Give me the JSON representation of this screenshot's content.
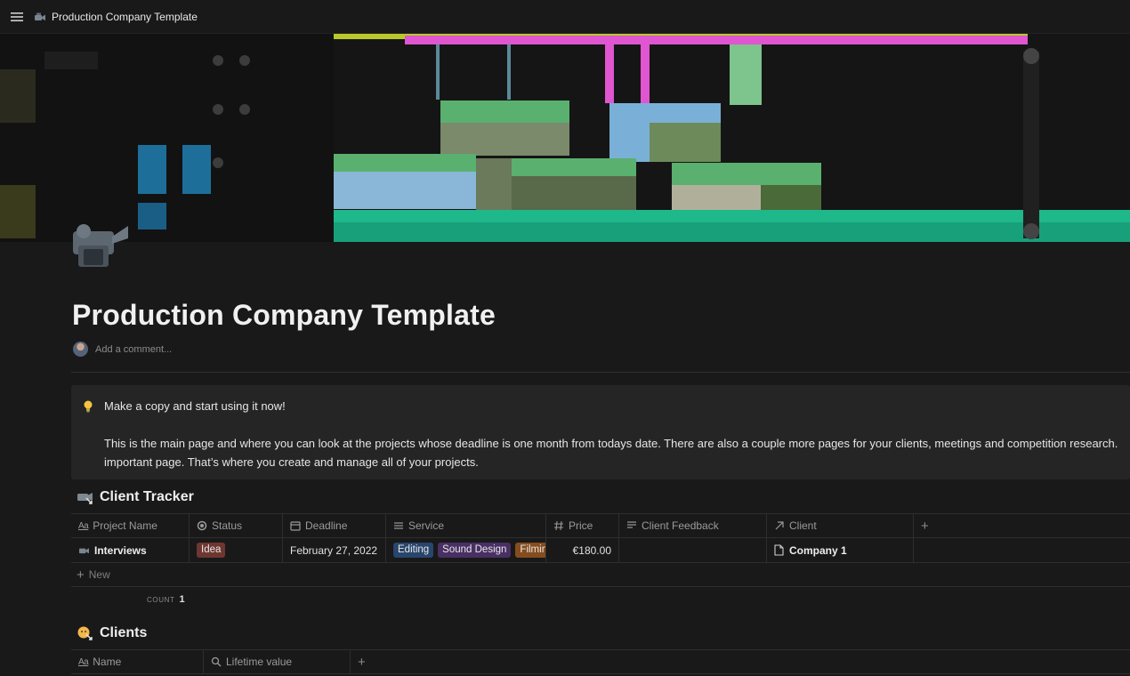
{
  "topbar": {
    "page_title": "Production Company Template",
    "menu_icon": "hamburger-menu-icon",
    "page_icon": "video-camera-icon"
  },
  "cover": {
    "image": "video-editing-timeline"
  },
  "page": {
    "title": "Production Company Template",
    "comment_placeholder": "Add a comment..."
  },
  "callout": {
    "icon": "lightbulb-icon",
    "title": "Make a copy and start using it now!",
    "body_line1": "This is the main page and where you can look at the projects whose deadline is one month from todays date. There are also a couple more pages for your clients, meetings and competition research.",
    "body_line2": "important page. That’s where you create and manage all of your projects."
  },
  "client_tracker": {
    "title": "Client Tracker",
    "columns": [
      "Project Name",
      "Status",
      "Deadline",
      "Service",
      "Price",
      "Client Feedback",
      "Client"
    ],
    "rows": [
      {
        "project_name": "Interviews",
        "status": "Idea",
        "deadline": "February 27, 2022",
        "services": [
          "Editing",
          "Sound Design",
          "Filmin"
        ],
        "price": "€180.00",
        "client_feedback": "",
        "client": "Company 1"
      }
    ],
    "new_label": "New",
    "count_label": "COUNT",
    "count_value": "1"
  },
  "clients": {
    "title": "Clients",
    "columns": [
      "Name",
      "Lifetime value"
    ]
  },
  "colors": {
    "background": "#191919",
    "tag_idea": "#6e3630",
    "tag_editing": "#28456c",
    "tag_sound_design": "#492f64",
    "tag_filming": "#854c1d"
  }
}
